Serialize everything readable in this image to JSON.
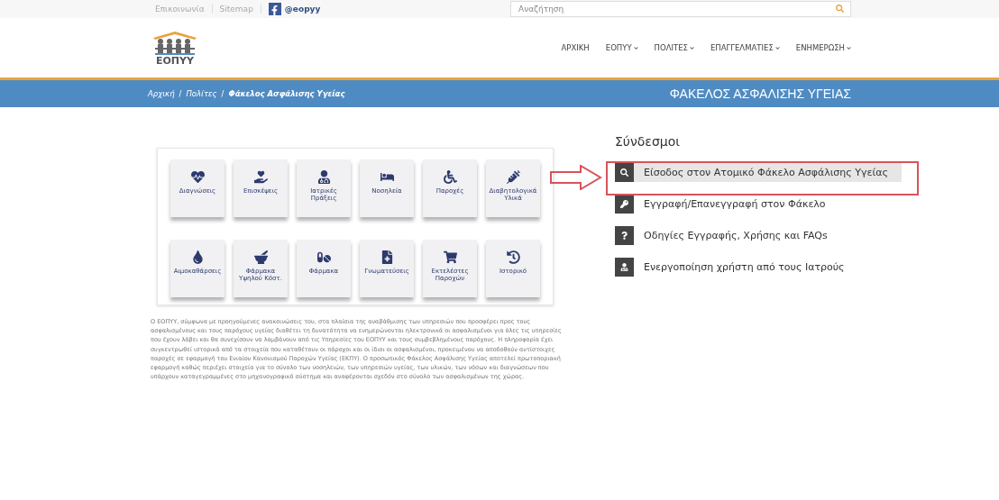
{
  "top_bar": {
    "links": [
      "Επικοινωνία",
      "Sitemap"
    ],
    "facebook": "@eopyy",
    "search": {
      "placeholder": "Αναζήτηση"
    }
  },
  "header": {
    "logo_text": "ΕΟΠΥΥ",
    "nav": [
      {
        "label": "ΑΡΧΙΚΗ",
        "dropdown": false
      },
      {
        "label": "ΕΟΠΥΥ",
        "dropdown": true
      },
      {
        "label": "ΠΟΛΙΤΕΣ",
        "dropdown": true
      },
      {
        "label": "ΕΠΑΓΓΕΛΜΑΤΙΕΣ",
        "dropdown": true
      },
      {
        "label": "ΕΝΗΜΕΡΩΣΗ",
        "dropdown": true
      }
    ]
  },
  "breadcrumb": {
    "separator": "/",
    "items": [
      "Αρχική",
      "Πολίτες",
      "Φάκελος Ασφάλισης Υγείας"
    ],
    "page_title": "ΦΑΚΕΛΟΣ ΑΣΦΑΛΙΣΗΣ ΥΓΕΙΑΣ"
  },
  "tiles": [
    "Διαγνώσεις",
    "Επισκέψεις",
    "Ιατρικές Πράξεις",
    "Νοσηλεία",
    "Παροχές",
    "Διαβητολογικά Υλικά",
    "Αιμοκαθάρσεις",
    "Φάρμακα Υψηλού Κόστ.",
    "Φάρμακα",
    "Γνωματεύσεις",
    "Εκτελέστες Παροχών",
    "Ιστορικό"
  ],
  "description": "Ο ΕΟΠΥΥ, σύμφωνα με προηγούμενες ανακοινώσεις του, στα πλαίσια της αναβάθμισης των υπηρεσιών που προσφέρει προς τους ασφαλισμένους και τους παρόχους υγείας διαθέτει τη δυνατότητα να ενημερώνονται ηλεκτρονικά οι ασφαλισμένοι για όλες τις υπηρεσίες που έχουν λάβει και θα συνεχίσουν να λαμβάνουν από τις Υπηρεσίες του ΕΟΠΥΥ και τους συμβεβλημένους παρόχους. Η πληροφορία έχει συγκεντρωθεί ιστορικά από τα στοιχεία που καταθέτουν οι πάροχοι και οι ίδιοι οι ασφαλισμένοι, προκειμένου να αποδοθούν αντίστοιχες παροχές σε εφαρμογή του Ενιαίου Κανονισμού Παροχών Υγείας (ΕΚΠΥ). Ο προσωπικός Φάκελος Ασφάλισης Υγείας αποτελεί πρωτοποριακή εφαρμογή καθώς περιέχει στοιχεία για το σύνολο των νοσηλειών, των υπηρεσιών υγείας, των υλικών, των νόσων και διαγνώσεων που υπάρχουν καταγεγραμμένες στο μηχανογραφικό σύστημα και αναφέρονται σχεδόν στο σύνολο των ασφαλισμένων της χώρας.",
  "links": {
    "title": "Σύνδεσμοι",
    "items": [
      {
        "label": "Είσοδος στον Ατομικό Φάκελο Ασφάλισης Υγείας",
        "selected": true
      },
      {
        "label": "Εγγραφή/Επανεγγραφή στον Φάκελο",
        "selected": false
      },
      {
        "label": "Οδηγίες Εγγραφής, Χρήσης και FAQs",
        "selected": false
      },
      {
        "label": "Ενεργοποίηση χρήστη από τους Ιατρούς",
        "selected": false
      }
    ]
  }
}
